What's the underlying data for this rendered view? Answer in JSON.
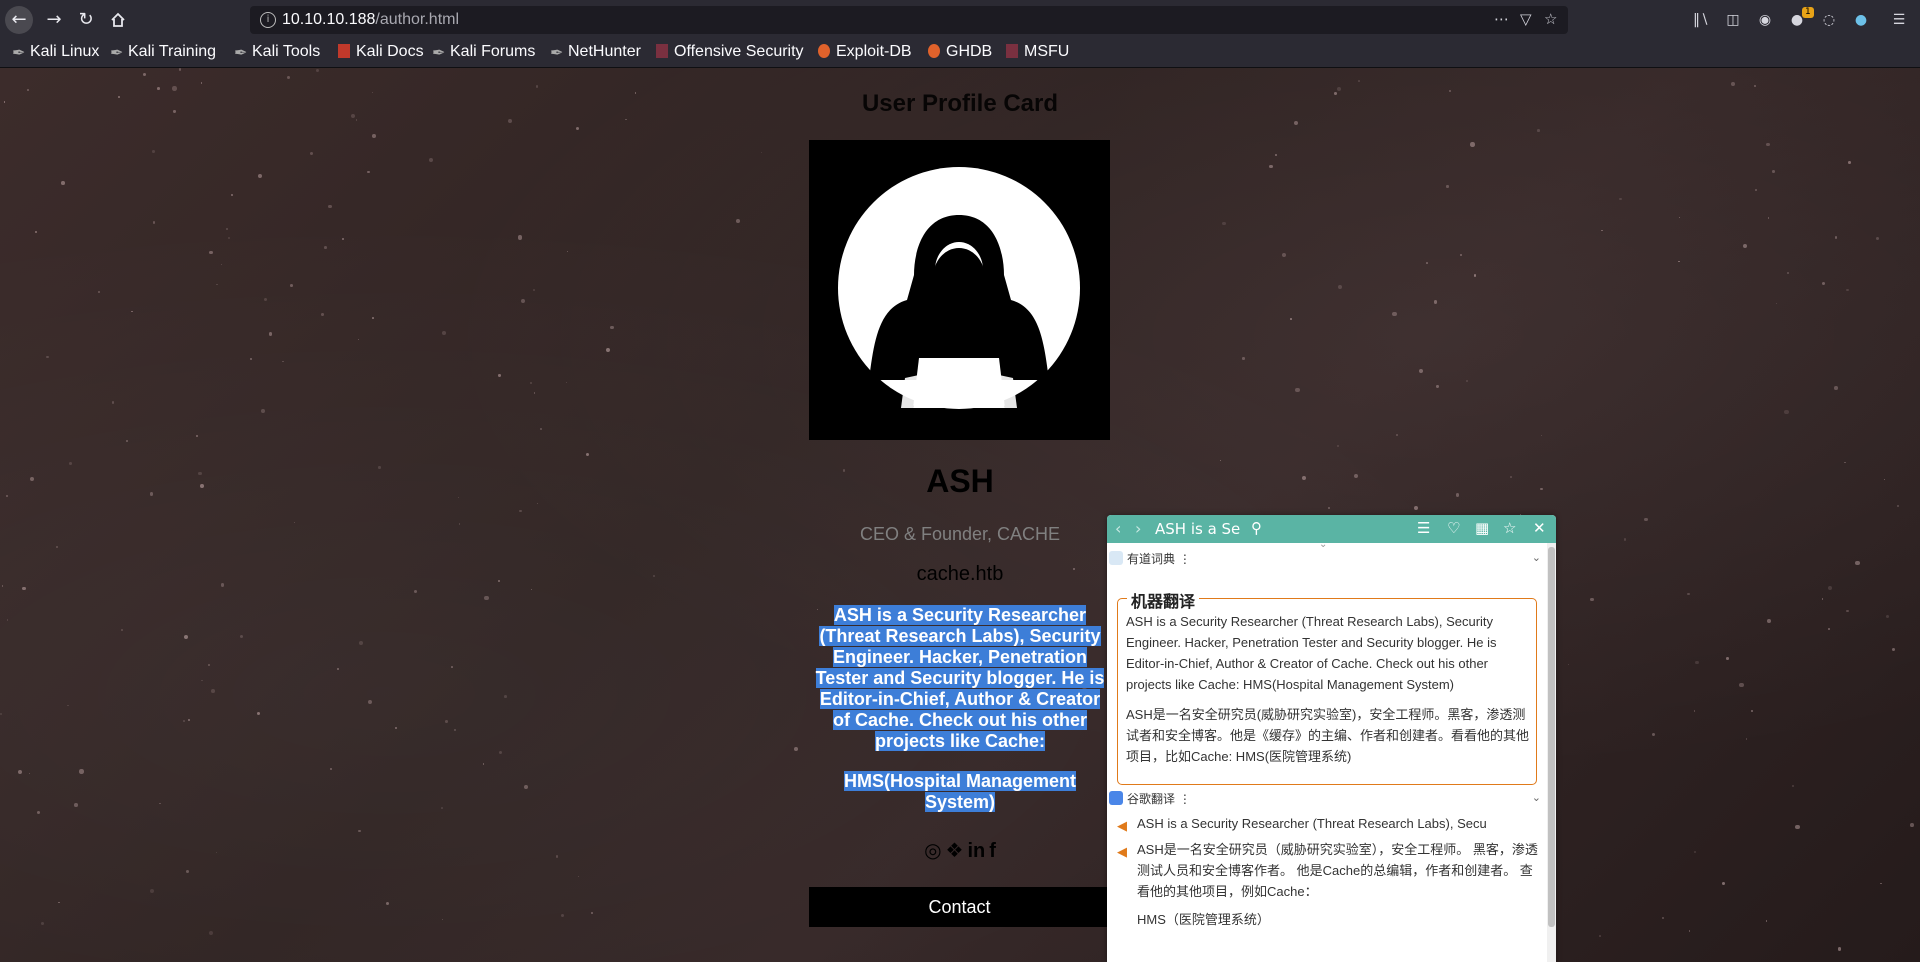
{
  "browser": {
    "url_host": "10.10.10.188",
    "url_path": "/author.html",
    "notification_count": "1",
    "bookmarks": [
      {
        "label": "Kali Linux"
      },
      {
        "label": "Kali Training"
      },
      {
        "label": "Kali Tools"
      },
      {
        "label": "Kali Docs"
      },
      {
        "label": "Kali Forums"
      },
      {
        "label": "NetHunter"
      },
      {
        "label": "Offensive Security"
      },
      {
        "label": "Exploit-DB"
      },
      {
        "label": "GHDB"
      },
      {
        "label": "MSFU"
      }
    ]
  },
  "profile": {
    "card_title": "User Profile Card",
    "name": "ASH",
    "role": "CEO & Founder, CACHE",
    "site": "cache.htb",
    "bio_1": "ASH is a Security Researcher (Threat Research Labs), Security Engineer. Hacker, Penetration Tester and Security blogger. He is Editor-in-Chief, Author & Creator of Cache. Check out his other projects like Cache:",
    "bio_2": "HMS(Hospital Management System)",
    "contact_label": "Contact"
  },
  "translator": {
    "search_value": "ASH is a Se",
    "youdao_label": "有道词典",
    "machine_title": "机器翻译",
    "machine_en": "ASH is a Security Researcher (Threat Research Labs), Security Engineer. Hacker, Penetration Tester and Security blogger. He is Editor-in-Chief, Author & Creator of Cache. Check out his other projects like Cache: HMS(Hospital Management System)",
    "machine_zh": "ASH是一名安全研究员(威胁研究实验室)，安全工程师。黑客，渗透测试者和安全博客。他是《缓存》的主编、作者和创建者。看看他的其他项目，比如Cache: HMS(医院管理系统)",
    "google_label": "谷歌翻译",
    "google_en": "ASH is a Security Researcher (Threat Research Labs), Secu",
    "google_zh_1": "ASH是一名安全研究员（威胁研究实验室），安全工程师。 黑客，渗透测试人员和安全博客作者。 他是Cache的总编辑，作者和创建者。 查看他的其他项目，例如Cache：",
    "google_zh_2": "HMS（医院管理系统）"
  },
  "colors": {
    "selection": "#3d7ed8",
    "popup_header": "#5ab4a4",
    "machine_border": "#e07a1a"
  },
  "icons": [
    "back-arrow-icon",
    "forward-arrow-icon",
    "reload-icon",
    "home-icon",
    "site-info-icon",
    "page-actions-icon",
    "pocket-icon",
    "bookmark-star-icon",
    "library-icon",
    "sidebar-icon",
    "account-icon",
    "extension-icon",
    "dribbble-icon",
    "twitter-icon",
    "linkedin-icon",
    "facebook-icon",
    "speaker-icon",
    "search-icon",
    "list-icon",
    "heart-icon",
    "note-icon",
    "pin-icon",
    "close-icon"
  ]
}
